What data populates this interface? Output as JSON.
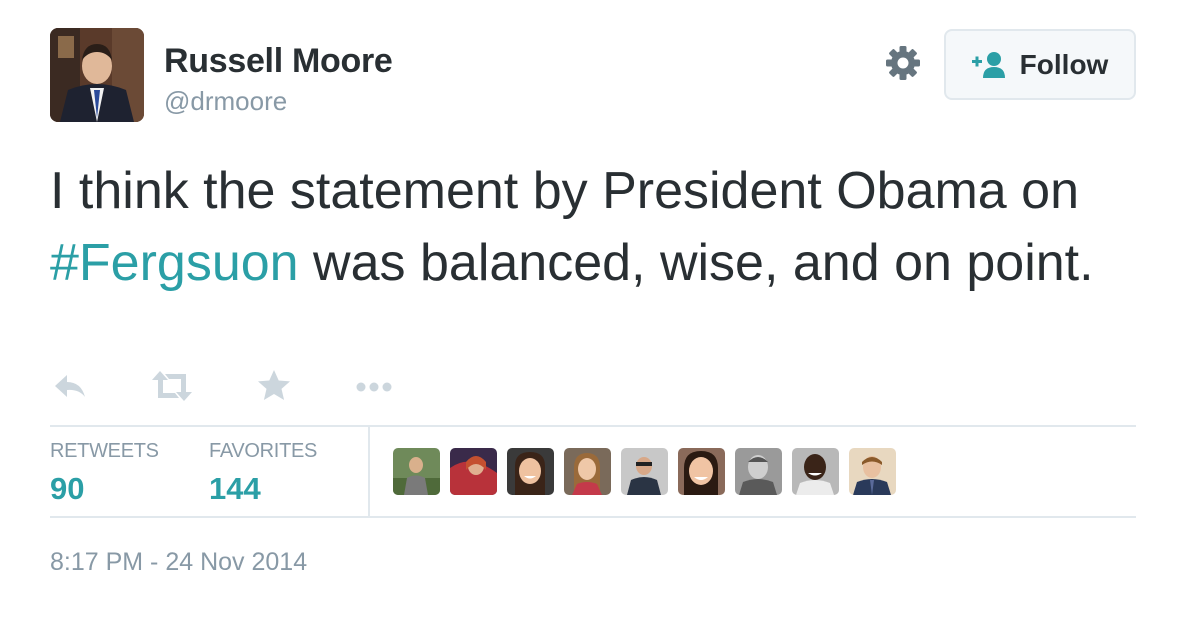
{
  "author": {
    "name": "Russell Moore",
    "handle": "@drmoore"
  },
  "follow_button": {
    "label": "Follow"
  },
  "tweet": {
    "text_before": "I think the statement by President Obama on ",
    "hashtag": "#Fergsuon",
    "text_after": " was balanced, wise, and on point."
  },
  "actions": [
    "reply-icon",
    "retweet-icon",
    "favorite-star-icon",
    "more-dots-icon"
  ],
  "stats": {
    "retweets_label": "RETWEETS",
    "retweets_value": "90",
    "favorites_label": "FAVORITES",
    "favorites_value": "144"
  },
  "favoriter_avatar_count": 9,
  "timestamp": "8:17 PM - 24 Nov 2014",
  "colors": {
    "link": "#2b9fa6",
    "muted": "#8899a6",
    "text": "#292f33",
    "follow_icon": "#2b9fa6",
    "border": "#e1e8ed"
  }
}
